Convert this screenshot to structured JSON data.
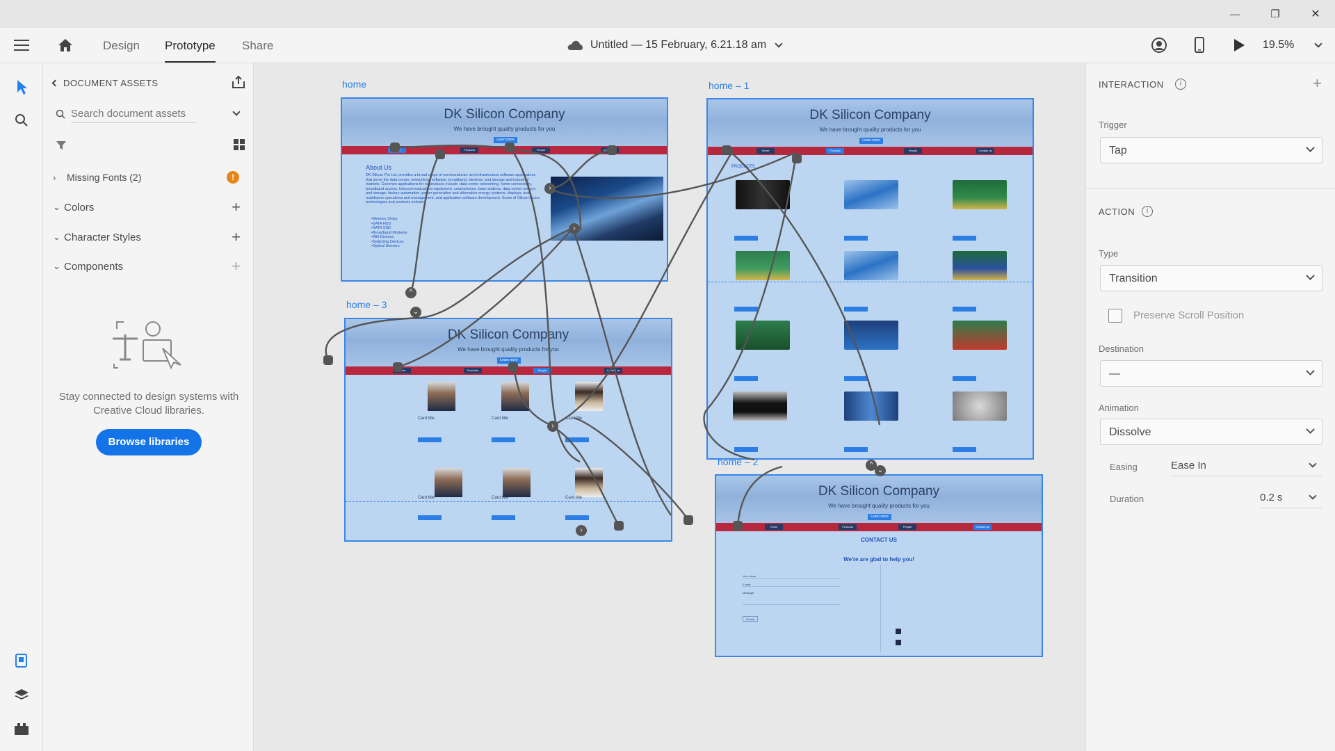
{
  "window": {
    "minimize_glyph": "—",
    "restore_glyph": "❐",
    "close_glyph": "✕"
  },
  "topbar": {
    "tabs": [
      {
        "label": "Design"
      },
      {
        "label": "Prototype"
      },
      {
        "label": "Share"
      }
    ],
    "document_title": "Untitled — 15 February, 6.21.18 am",
    "zoom": "19.5%"
  },
  "assets": {
    "header": "DOCUMENT ASSETS",
    "search_placeholder": "Search document assets",
    "sections": {
      "missing_fonts": "Missing Fonts (2)",
      "missing_fonts_badge": "!",
      "colors": "Colors",
      "character_styles": "Character Styles",
      "components": "Components"
    },
    "cc_message": "Stay connected to design systems with Creative Cloud libraries.",
    "browse_button": "Browse libraries"
  },
  "canvas": {
    "artboards": {
      "home": {
        "label": "home",
        "title": "DK Silicon Company",
        "subtitle": "We have brought quality products for you",
        "learn": "Learn more",
        "nav": [
          "Home",
          "Products",
          "People",
          "Contact us"
        ],
        "about_heading": "About Us",
        "about_text": "DK Silicon Pvt Ltd. provides a broad range of semiconductor and infrastructure software applications that serve the data center, networking, software, broadband, wireless, and storage and industrial markets. Common applications for its products include: data center networking, home connectivity, broadband access, telecommunications equipment, smartphones, base stations, data center servers and storage, factory automation, power generation and alternative energy systems, displays, and mainframe operations and management, and application software development. Some of Silicon's core technologies and products include:",
        "about_list": [
          "•Memory Chips",
          "•SATA HDD",
          "•SATA SSD",
          "•Broadband Modems",
          "•Wifi Devices",
          "•Switching Devices",
          "•Optical Sensors"
        ]
      },
      "home1": {
        "label": "home – 1",
        "title": "DK Silicon Company",
        "subtitle": "We have brought quality products for you",
        "learn": "Learn more",
        "nav": [
          "Home",
          "Products",
          "People",
          "Contact us"
        ],
        "products_heading": "PRODUCTS"
      },
      "home2": {
        "label": "home – 2",
        "title": "DK Silicon Company",
        "subtitle": "We have brought quality products for you",
        "learn": "Learn more",
        "nav": [
          "Home",
          "Products",
          "People",
          "Contact us"
        ],
        "contact_heading": "CONTACT US",
        "contact_sub": "We're are glad to help you!",
        "fields": [
          "Your name",
          "E-mail",
          "Message"
        ],
        "submit": "Submit"
      },
      "home3": {
        "label": "home – 3",
        "title": "DK Silicon Company",
        "subtitle": "We have brought quality products for you",
        "learn": "Learn more",
        "nav": [
          "Home",
          "Products",
          "People",
          "Contact us"
        ],
        "card_title": "Card title"
      }
    }
  },
  "interaction": {
    "header": "INTERACTION",
    "trigger_label": "Trigger",
    "trigger_value": "Tap"
  },
  "action": {
    "header": "ACTION",
    "type_label": "Type",
    "type_value": "Transition",
    "preserve_label": "Preserve Scroll Position",
    "destination_label": "Destination",
    "destination_value": "—",
    "animation_label": "Animation",
    "animation_value": "Dissolve",
    "easing_label": "Easing",
    "easing_value": "Ease In",
    "duration_label": "Duration",
    "duration_value": "0.2 s"
  },
  "colors": {
    "accent": "#2680eb",
    "nav_red": "#b7283f",
    "warning": "#e68619"
  }
}
